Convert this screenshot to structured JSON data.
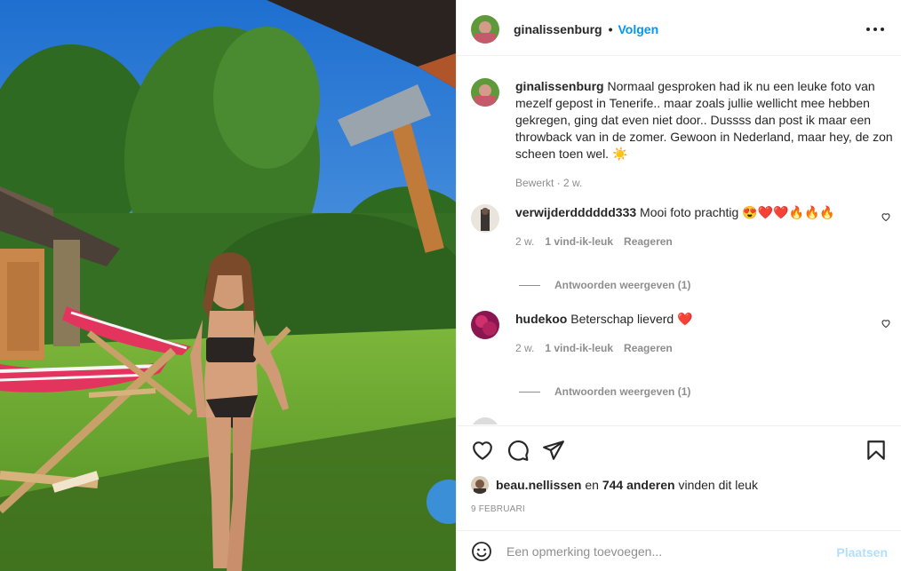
{
  "post": {
    "author": "ginalissenburg",
    "follow_label": "Volgen",
    "separator": "•"
  },
  "caption": {
    "author": "ginalissenburg",
    "text": "Normaal gesproken had ik nu een leuke foto van mezelf gepost in Tenerife.. maar zoals jullie wellicht mee hebben gekregen, ging dat even niet door.. Dussss dan post ik maar een throwback van in de zomer. Gewoon in Nederland, maar hey, de zon scheen toen wel. ☀️",
    "meta": "Bewerkt · 2 w."
  },
  "comments": [
    {
      "author": "verwijderdddddd333",
      "text": "Mooi foto prachtig 😍❤️❤️🔥🔥🔥",
      "time": "2 w.",
      "likes": "1 vind-ik-leuk",
      "reply_label": "Reageren",
      "view_replies": "Antwoorden weergeven (1)"
    },
    {
      "author": "hudekoo",
      "text": "Beterschap lieverd ❤️",
      "time": "2 w.",
      "likes": "1 vind-ik-leuk",
      "reply_label": "Reageren",
      "view_replies": "Antwoorden weergeven (1)"
    }
  ],
  "likes": {
    "user": "beau.nellissen",
    "connector": "en",
    "count_text": "744 anderen",
    "suffix": "vinden dit leuk"
  },
  "date": "9 FEBRUARI",
  "add_comment": {
    "placeholder": "Een opmerking toevoegen...",
    "post_label": "Plaatsen"
  },
  "icons": {
    "like": "heart-icon",
    "comment": "comment-bubble-icon",
    "share": "paper-plane-icon",
    "save": "bookmark-icon",
    "more": "more-options-icon",
    "emoji": "smiley-icon"
  },
  "colors": {
    "accent": "#0095f6",
    "post_disabled": "#b2dffc",
    "muted": "#8e8e8e",
    "text": "#262626"
  }
}
